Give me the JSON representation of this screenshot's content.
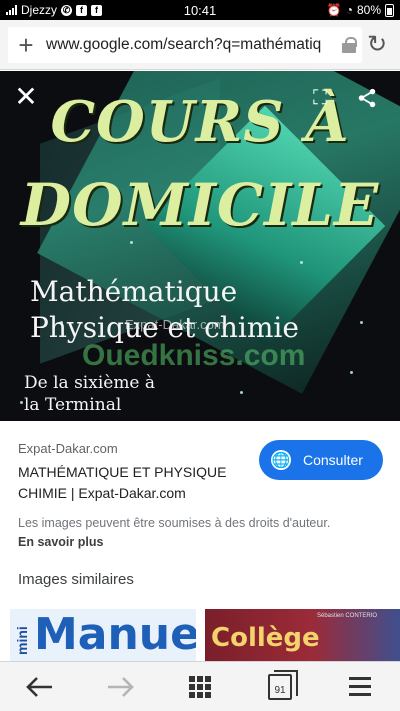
{
  "status_bar": {
    "carrier": "Djezzy",
    "time": "10:41",
    "battery": "80%"
  },
  "browser": {
    "url": "www.google.com/search?q=mathématiq"
  },
  "image_text": {
    "title_line1": "COURS À",
    "title_line2": "DOMICILE",
    "subject_line1": "Mathématique",
    "subject_line2": "Physique et chimie",
    "level_line1": "De la sixième à",
    "level_line2": "la Terminal",
    "watermark": "Ouedkniss.com",
    "watermark_small": "Expat-Dakar.com"
  },
  "result": {
    "source": "Expat-Dakar.com",
    "title": "MATHÉMATIQUE ET PHYSIQUE CHIMIE | Expat-Dakar.com",
    "consult_label": "Consulter",
    "rights_text": "Les images peuvent être soumises à des droits d'auteur.",
    "learn_more": "En savoir plus",
    "similar_heading": "Images similaires"
  },
  "similar_images": [
    {
      "text_main": "Manuel",
      "text_side": "mini"
    },
    {
      "text_main": "Collège",
      "text_side": "Sébastien CONTERIO"
    }
  ],
  "bottom_nav": {
    "tab_count": "91"
  },
  "colors": {
    "accent": "#1a73e8",
    "status_bar": "#000000",
    "title_yellow": "#dcefa0"
  }
}
